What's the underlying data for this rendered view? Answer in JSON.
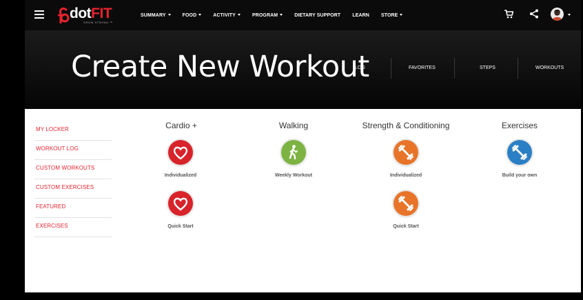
{
  "nav": {
    "logo_text": "dot",
    "logo_text_accent": "FIT",
    "logo_tagline": "GROW STRONG.™",
    "menu": [
      {
        "label": "SUMMARY",
        "has_caret": true
      },
      {
        "label": "FOOD",
        "has_caret": true
      },
      {
        "label": "ACTIVITY",
        "has_caret": true
      },
      {
        "label": "PROGRAM",
        "has_caret": true
      },
      {
        "label": "DIETARY SUPPORT",
        "has_caret": false
      },
      {
        "label": "LEARN",
        "has_caret": false
      },
      {
        "label": "STORE",
        "has_caret": true
      }
    ],
    "icons": [
      "menu-icon",
      "cart-icon",
      "share-icon",
      "avatar-icon"
    ]
  },
  "hero": {
    "title": "Create New Workout",
    "tabs": [
      "LOG",
      "FAVORITES",
      "STEPS",
      "WORKOUTS"
    ]
  },
  "sidebar": {
    "items": [
      "MY LOCKER",
      "WORKOUT LOG",
      "CUSTOM WORKOUTS",
      "CUSTOM EXERCISES",
      "FEATURED",
      "EXERCISES"
    ]
  },
  "workouts": {
    "columns": [
      {
        "title": "Cardio +",
        "tiles": [
          {
            "label": "Individualized",
            "icon": "heart-icon",
            "color": "#d8232a"
          },
          {
            "label": "Quick Start",
            "icon": "heart-icon",
            "color": "#d8232a"
          }
        ]
      },
      {
        "title": "Walking",
        "tiles": [
          {
            "label": "Weekly Workout",
            "icon": "walking-icon",
            "color": "#7cb342"
          }
        ]
      },
      {
        "title": "Strength & Conditioning",
        "tiles": [
          {
            "label": "Individualized",
            "icon": "dumbbell-icon",
            "color": "#e8742a"
          },
          {
            "label": "Quick Start",
            "icon": "dumbbell-icon",
            "color": "#e8742a"
          }
        ]
      },
      {
        "title": "Exercises",
        "tiles": [
          {
            "label": "Build your own",
            "icon": "dumbbell-icon",
            "color": "#2b7fc4"
          }
        ]
      }
    ]
  },
  "colors": {
    "accent_red": "#e8232e",
    "cardio_red": "#d8232a",
    "walking_green": "#7cb342",
    "strength_orange": "#e8742a",
    "exercise_blue": "#2b7fc4"
  }
}
